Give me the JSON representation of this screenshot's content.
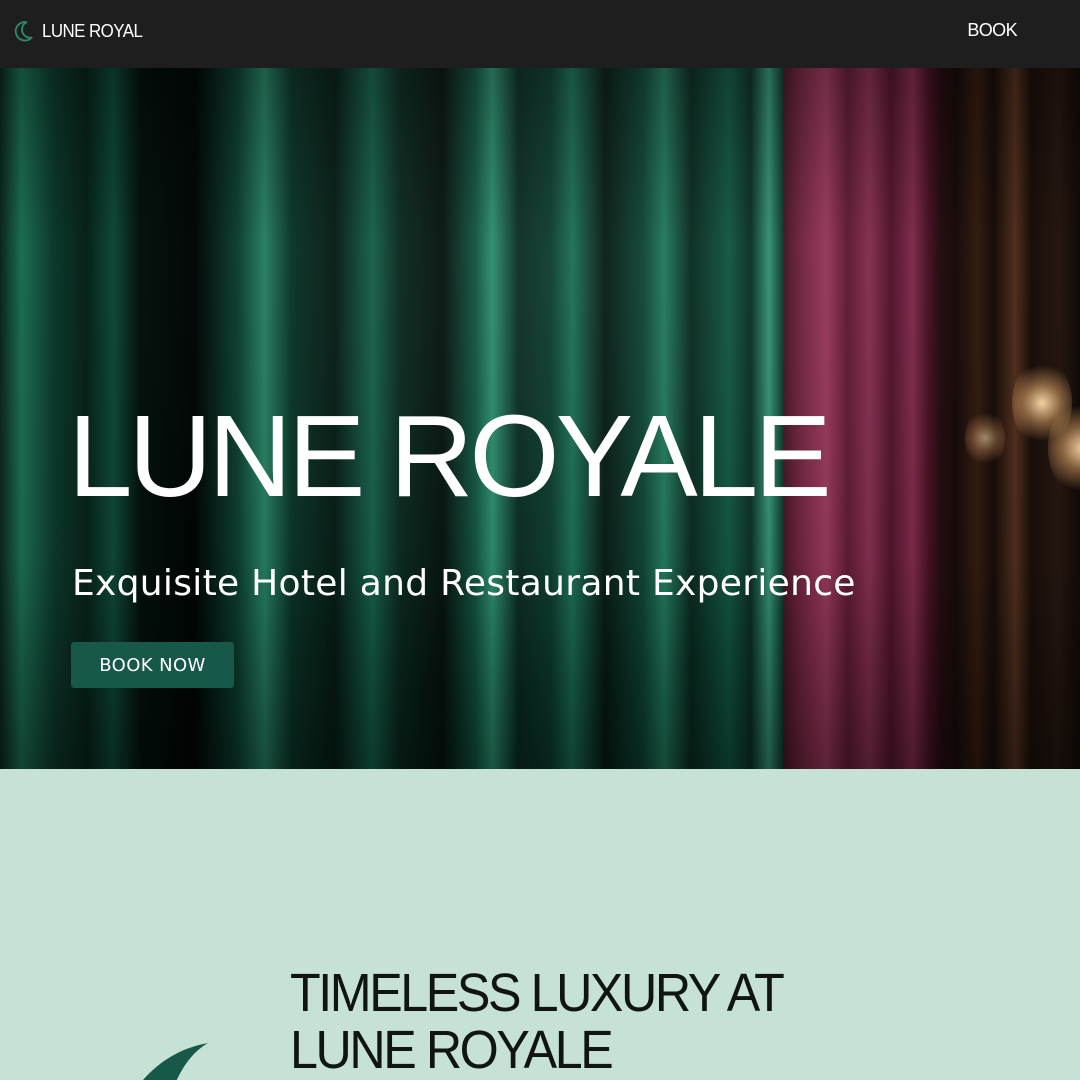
{
  "nav": {
    "brand_name": "LUNE ROYAL",
    "brand_icon": "crescent-moon-icon",
    "book_link": "BOOK"
  },
  "hero": {
    "title": "LUNE ROYALE",
    "subtitle": "Exquisite Hotel and Restaurant Experience",
    "cta_label": "BOOK NOW"
  },
  "about": {
    "heading": "TIMELESS LUXURY AT LUNE ROYALE",
    "decor_icon": "leaf-icon"
  },
  "colors": {
    "nav_background": "#1e1e1e",
    "accent_green": "#175848",
    "section_mint": "#c6e2d5",
    "text_light": "#ffffff",
    "text_dark": "#101512"
  }
}
